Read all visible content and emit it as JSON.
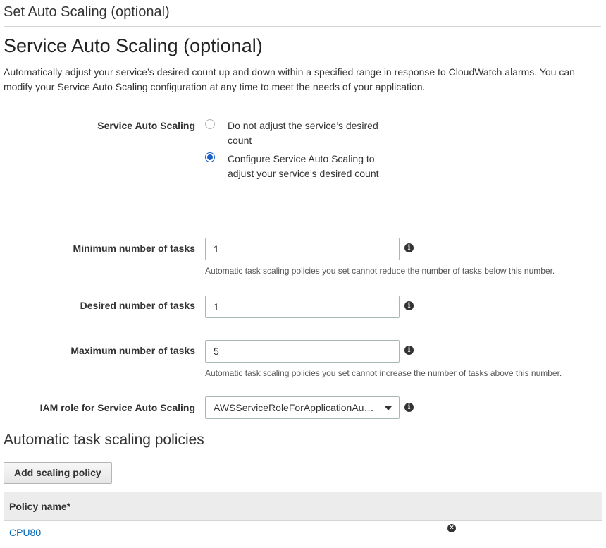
{
  "header": {
    "title": "Set Auto Scaling (optional)"
  },
  "section": {
    "title": "Service Auto Scaling (optional)",
    "description": "Automatically adjust your service’s desired count up and down within a specified range in response to CloudWatch alarms. You can modify your Service Auto Scaling configuration at any time to meet the needs of your application."
  },
  "auto_scaling": {
    "label": "Service Auto Scaling",
    "options": [
      {
        "label": "Do not adjust the service’s desired count",
        "selected": false
      },
      {
        "label": "Configure Service Auto Scaling to adjust your service’s desired count",
        "selected": true
      }
    ]
  },
  "fields": {
    "min_tasks": {
      "label": "Minimum number of tasks",
      "value": "1",
      "help": "Automatic task scaling policies you set cannot reduce the number of tasks below this number."
    },
    "desired_tasks": {
      "label": "Desired number of tasks",
      "value": "1"
    },
    "max_tasks": {
      "label": "Maximum number of tasks",
      "value": "5",
      "help": "Automatic task scaling policies you set cannot increase the number of tasks above this number."
    },
    "iam_role": {
      "label": "IAM role for Service Auto Scaling",
      "value": "AWSServiceRoleForApplicationAutoScaling_ECSService"
    }
  },
  "policies": {
    "title": "Automatic task scaling policies",
    "add_button": "Add scaling policy",
    "columns": [
      "Policy name*",
      ""
    ],
    "rows": [
      {
        "name": "CPU80"
      }
    ]
  },
  "icons": {
    "info": "info-icon",
    "remove": "remove-icon",
    "dropdown": "chevron-down-icon"
  }
}
